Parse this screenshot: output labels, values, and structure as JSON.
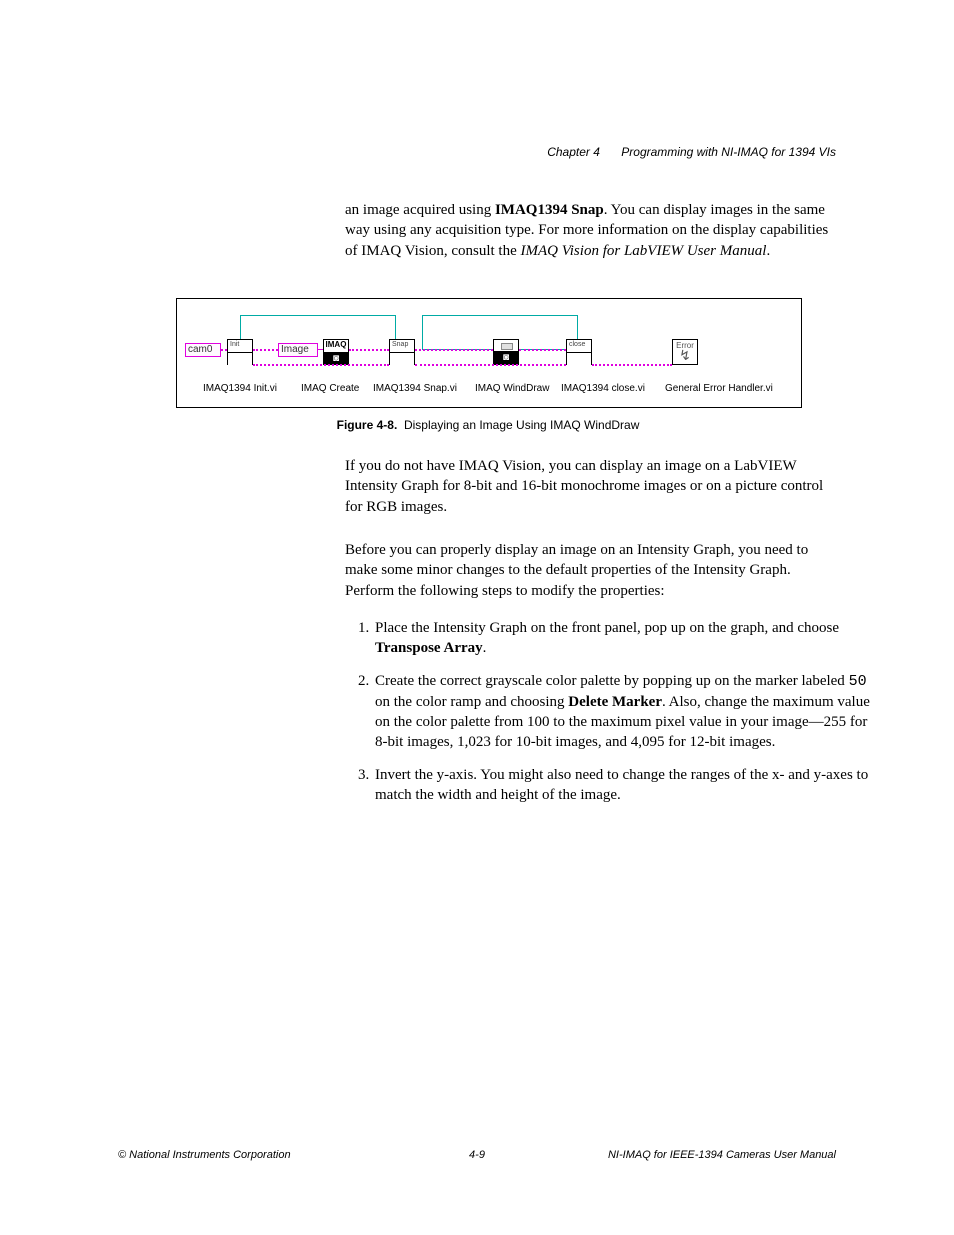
{
  "header": {
    "chapter_num": "Chapter 4",
    "chapter_title": "Programming with NI-IMAQ for 1394 VIs"
  },
  "para1": {
    "t1": "an image acquired using ",
    "b1": "IMAQ1394 Snap",
    "t2": ". You can display images in the same way using any acquisition type. For more information on the display capabilities of IMAQ Vision, consult the ",
    "i1": "IMAQ Vision for LabVIEW User Manual",
    "t3": "."
  },
  "figure": {
    "caption_num": "Figure 4-8.",
    "caption_text": "Displaying an Image Using IMAQ WindDraw",
    "input_cam": "cam0",
    "input_image": "Image",
    "node_init": "Init",
    "node_imaq": "IMAQ",
    "node_snap": "Snap",
    "node_close": "close",
    "node_error": "Error",
    "labels": {
      "l1": "IMAQ1394 Init.vi",
      "l2": "IMAQ Create",
      "l3": "IMAQ1394 Snap.vi",
      "l4": "IMAQ WindDraw",
      "l5": "IMAQ1394 close.vi",
      "l6": "General Error Handler.vi"
    }
  },
  "para2": "If you do not have IMAQ Vision, you can display an image on a LabVIEW Intensity Graph for 8-bit and 16-bit monochrome images or on a picture control for RGB images.",
  "para3": "Before you can properly display an image on an Intensity Graph, you need to make some minor changes to the default properties of the Intensity Graph. Perform the following steps to modify the properties:",
  "steps": {
    "s1a": "Place the Intensity Graph on the front panel, pop up on the graph, and choose ",
    "s1b": "Transpose Array",
    "s1c": ".",
    "s2a": "Create the correct grayscale color palette by popping up on the marker labeled ",
    "s2code": "50",
    "s2b": " on the color ramp and choosing ",
    "s2bold": "Delete Marker",
    "s2c": ". Also, change the maximum value on the color palette from 100 to the maximum pixel value in your image—255 for 8-bit images, 1,023 for 10-bit images, and 4,095 for 12-bit images.",
    "s3": "Invert the y-axis. You might also need to change the ranges of the x- and y-axes to match the width and height of the image."
  },
  "footer": {
    "left": "© National Instruments Corporation",
    "center": "4-9",
    "right": "NI-IMAQ for IEEE-1394 Cameras User Manual"
  }
}
